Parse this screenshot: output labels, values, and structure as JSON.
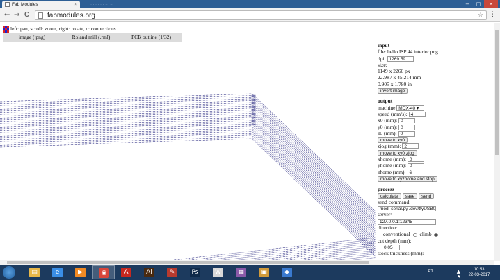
{
  "browser": {
    "tab_title": "Fab Modules",
    "tab_close": "×",
    "ghost_tabs": "… … … … …",
    "url": "fabmodules.org",
    "back": "←",
    "forward": "→",
    "reload": "C",
    "star": "☆",
    "menu": "⋮",
    "minimize": "−",
    "maximize": "□",
    "close": "✕"
  },
  "page": {
    "instructions": "left: pan, scroll: zoom, right: rotate, c: connections",
    "grid_icon_colors": [
      "#d22",
      "#22c",
      "#d22",
      "#22c",
      "#d22",
      "#22c",
      "#d22",
      "#22c",
      "#d22"
    ],
    "tabs": [
      "image (.png)",
      "Roland mill (.rml)",
      "PCB outline (1/32)"
    ]
  },
  "panel": {
    "input": {
      "heading": "input",
      "file": "file: hello.ISP.44.interior.png",
      "dpi_label": "dpi:",
      "dpi_value": "1269.59",
      "size_label": "size:",
      "size_px": "1149 x 2260 px",
      "size_mm": "22.987 x 45.214 mm",
      "size_in": "0.905 x 1.780 in",
      "invert_button": "invert image"
    },
    "output": {
      "heading": "output",
      "machine_label": "machine",
      "machine_value": "MDX-40",
      "speed_label": "speed (mm/s):",
      "speed_value": "4",
      "x0_label": "x0 (mm):",
      "x0_value": "0",
      "y0_label": "y0 (mm):",
      "y0_value": "0",
      "z0_label": "z0 (mm):",
      "z0_value": "0",
      "move_xy0_button": "move to xy0",
      "zjog_label": "zjog (mm):",
      "zjog_value": "2",
      "move_xy0zjog_button": "move to xy0 zjog",
      "xhome_label": "xhome (mm):",
      "xhome_value": "0",
      "yhome_label": "yhome (mm):",
      "yhome_value": "0",
      "zhome_label": "zhome (mm):",
      "zhome_value": "6",
      "move_home_button": "move to xyzhome and stop"
    },
    "process": {
      "heading": "process",
      "calculate_button": "calculate",
      "save_button": "save",
      "send_button": "send",
      "send_command_label": "send command:",
      "send_command_value": "mod_serial.py /dev/ttyUSB0",
      "server_label": "server:",
      "server_value": "127.0.0.1:12345",
      "direction_label": "direction:",
      "conventional_label": "conventional",
      "climb_label": "climb",
      "cut_depth_label": "cut depth (mm):",
      "cut_depth_value": "0.05",
      "stock_label": "stock thickness (mm):"
    }
  },
  "taskbar": {
    "apps": [
      {
        "name": "explorer",
        "glyph": "▤",
        "color": "#e8b84a"
      },
      {
        "name": "internet-explorer",
        "glyph": "e",
        "color": "#3a8ee6"
      },
      {
        "name": "media-player",
        "glyph": "▶",
        "color": "#f08a24"
      },
      {
        "name": "chrome",
        "glyph": "◉",
        "color": "#d9463b"
      },
      {
        "name": "acrobat",
        "glyph": "A",
        "color": "#c8281f"
      },
      {
        "name": "illustrator",
        "glyph": "Ai",
        "color": "#4a2a0f"
      },
      {
        "name": "pdf",
        "glyph": "✎",
        "color": "#b83a2e"
      },
      {
        "name": "photoshop",
        "glyph": "Ps",
        "color": "#0f2a4a"
      },
      {
        "name": "word",
        "glyph": "W",
        "color": "#d8d8d8"
      },
      {
        "name": "winrar",
        "glyph": "▦",
        "color": "#8a5aa8"
      },
      {
        "name": "folder",
        "glyph": "▣",
        "color": "#d09a3a"
      },
      {
        "name": "app",
        "glyph": "◆",
        "color": "#3a7ad0"
      }
    ],
    "lang": "PT",
    "time": "10:53",
    "date": "22-03-2017"
  },
  "colors": {
    "toolpath": "#3a3a8a",
    "tabstrip": "#2e5f95",
    "taskbar": "#1c3a5e"
  }
}
